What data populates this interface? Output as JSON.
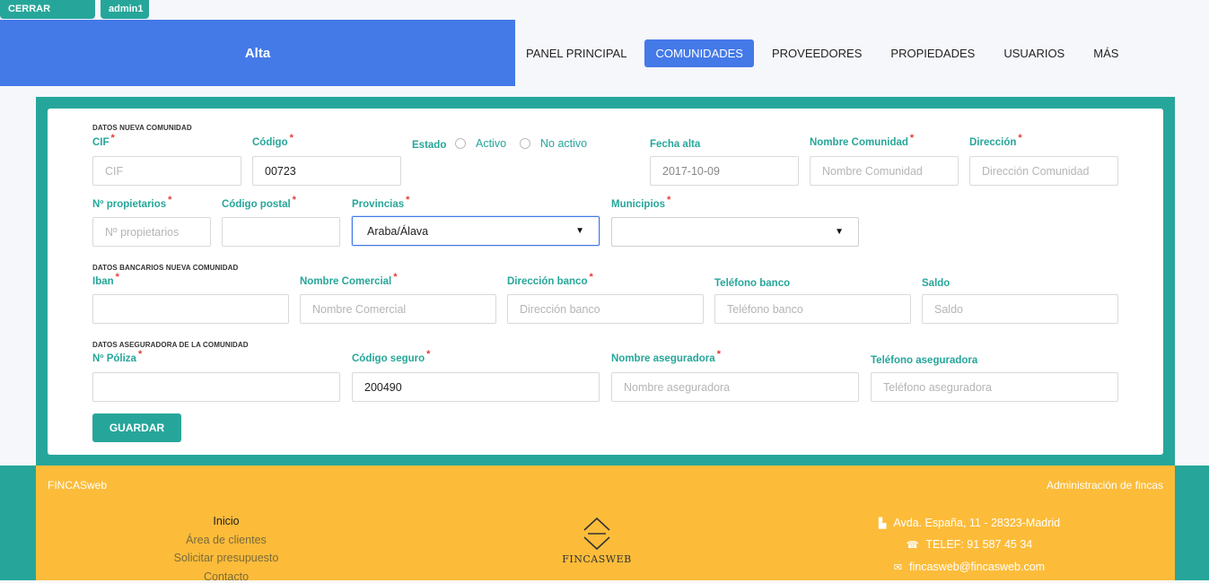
{
  "topbar": {
    "logout_label": "CERRAR SESIÓN",
    "user_label": "admin1"
  },
  "header": {
    "title": "Alta"
  },
  "nav": {
    "items": [
      {
        "label": "PANEL PRINCIPAL"
      },
      {
        "label": "COMUNIDADES",
        "active": true
      },
      {
        "label": "PROVEEDORES"
      },
      {
        "label": "PROPIEDADES"
      },
      {
        "label": "USUARIOS"
      },
      {
        "label": "MÁS"
      }
    ]
  },
  "form": {
    "section_comunidad": "DATOS NUEVA COMUNIDAD",
    "section_bancarios": "DATOS BANCARIOS NUEVA COMUNIDAD",
    "section_aseguradora": "DATOS ASEGURADORA DE LA COMUNIDAD",
    "required_mark": "*",
    "cif": {
      "label": "CIF",
      "placeholder": "CIF",
      "value": ""
    },
    "codigo": {
      "label": "Código",
      "value": "00723"
    },
    "estado": {
      "label": "Estado",
      "option_activo": "Activo",
      "option_no_activo": "No activo"
    },
    "fecha_alta": {
      "label": "Fecha alta",
      "value": "2017-10-09"
    },
    "nombre_comunidad": {
      "label": "Nombre Comunidad",
      "placeholder": "Nombre Comunidad"
    },
    "direccion": {
      "label": "Dirección",
      "placeholder": "Dirección Comunidad"
    },
    "n_propietarios": {
      "label": "Nº propietarios",
      "placeholder": "Nº propietarios"
    },
    "codigo_postal": {
      "label": "Código postal",
      "value": ""
    },
    "provincias": {
      "label": "Provincias",
      "selected": "Araba/Álava"
    },
    "municipios": {
      "label": "Municipios",
      "selected": ""
    },
    "iban": {
      "label": "Iban",
      "value": ""
    },
    "nombre_comercial": {
      "label": "Nombre Comercial",
      "placeholder": "Nombre Comercial"
    },
    "direccion_banco": {
      "label": "Dirección banco",
      "placeholder": "Dirección banco"
    },
    "telefono_banco": {
      "label": "Teléfono banco",
      "placeholder": "Teléfono banco"
    },
    "saldo": {
      "label": "Saldo",
      "placeholder": "Saldo"
    },
    "n_poliza": {
      "label": "Nº Póliza",
      "value": ""
    },
    "codigo_seguro": {
      "label": "Código seguro",
      "value": "200490"
    },
    "nombre_aseguradora": {
      "label": "Nombre aseguradora",
      "placeholder": "Nombre aseguradora"
    },
    "telefono_aseguradora": {
      "label": "Teléfono aseguradora",
      "placeholder": "Teléfono aseguradora"
    },
    "save_label": "GUARDAR"
  },
  "footer": {
    "brand": "FINCASweb",
    "tagline": "Administración de fincas",
    "links": [
      "Inicio",
      "Área de clientes",
      "Solicitar presupuesto",
      "Contacto"
    ],
    "logo_text": "FINCASWEB",
    "address": "Avda. España, 11 - 28323-Madrid",
    "phone": "TELEF: 91 587 45 34",
    "email": "fincasweb@fincasweb.com"
  },
  "colors": {
    "teal": "#26a69a",
    "blue": "#4479e8",
    "yellow": "#fcbc3a",
    "required": "#e53935"
  },
  "icons": [
    "building-icon",
    "phone-icon",
    "envelope-icon",
    "fincasweb-logo-icon"
  ]
}
